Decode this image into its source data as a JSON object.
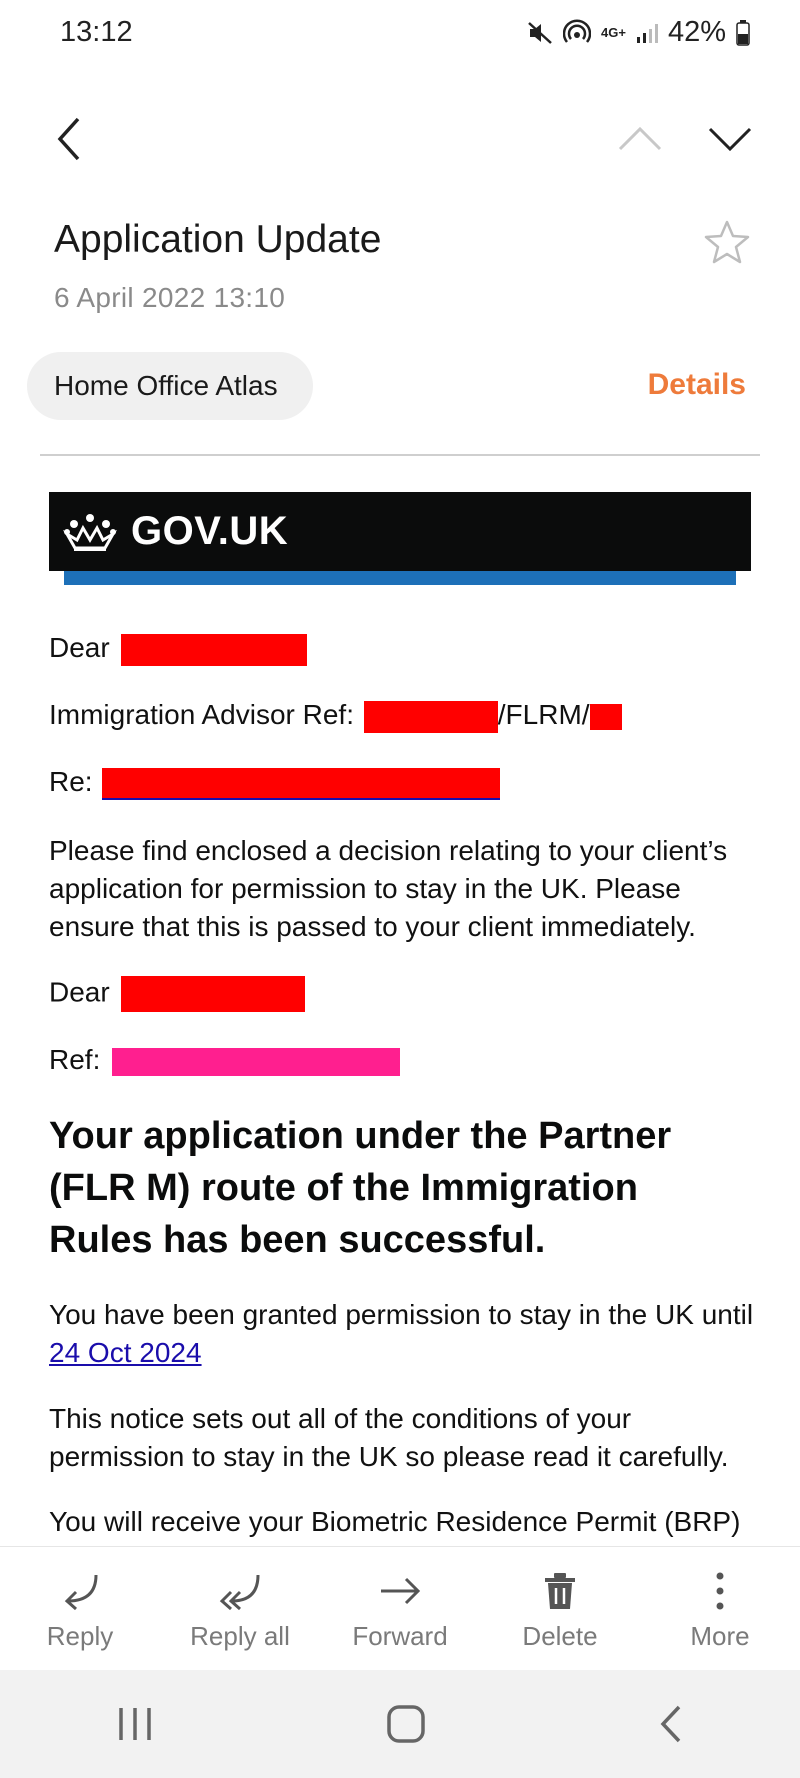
{
  "status_bar": {
    "time": "13:12",
    "battery": "42%",
    "network": "4G+",
    "icons": [
      "mute-icon",
      "hotspot-icon",
      "network-icon",
      "signal-icon",
      "battery-icon"
    ]
  },
  "email": {
    "subject": "Application Update",
    "date": "6 April 2022  13:10",
    "sender": "Home Office Atlas",
    "details_label": "Details",
    "banner_text": "GOV.UK",
    "dear_label": "Dear",
    "advisor_ref_label": "Immigration Advisor Ref:",
    "advisor_ref_middle": "/FLRM/",
    "re_label": "Re:",
    "intro_paragraph": "Please find enclosed a decision relating to your client’s application for permission to stay in the UK. Please ensure that this is passed to your client immediately.",
    "dear_label_2": "Dear",
    "ref_label": "Ref:",
    "heading": "Your application under the Partner (FLR M) route of the Immigration Rules has been successful.",
    "granted_text": "You have been granted permission to stay in the UK until ",
    "granted_date": "24 Oct 2024",
    "conditions_text": "This notice sets out all of the conditions of your permission to stay in the UK so please read it carefully.",
    "brp_text": "You will receive your Biometric Residence Permit (BRP)"
  },
  "toolbar": {
    "reply": "Reply",
    "reply_all": "Reply all",
    "forward": "Forward",
    "delete": "Delete",
    "more": "More"
  },
  "colors": {
    "accent": "#ee7b3b",
    "gov_black": "#0b0c0c",
    "gov_blue": "#1d70b8",
    "redaction_red": "#ff0000",
    "redaction_pink": "#ff1f8f",
    "link": "#1a0dab"
  }
}
